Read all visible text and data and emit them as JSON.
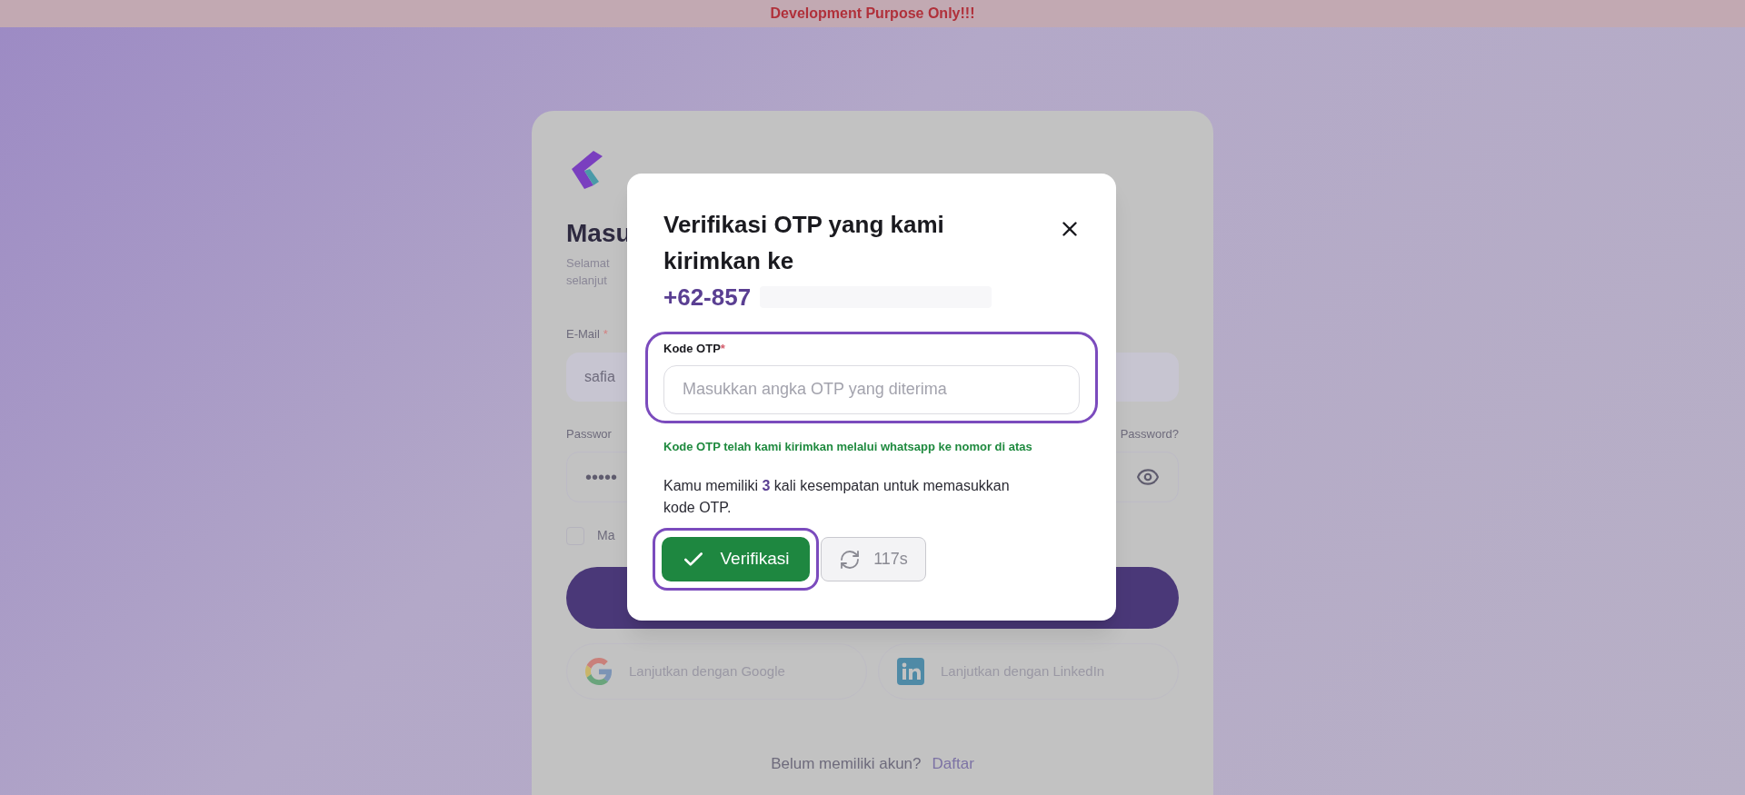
{
  "banner": {
    "text": "Development Purpose Only!!!"
  },
  "login_card": {
    "heading": "Masu",
    "subtitle_lines": [
      "Selamat",
      "selanjut"
    ],
    "email": {
      "label": "E-Mail",
      "required": true,
      "required_mark": "*",
      "value": "safia"
    },
    "password": {
      "label": "Passwor",
      "value": "•••••",
      "forgot_link": "Password?"
    },
    "remember": {
      "label": "Ma",
      "checked": false
    },
    "social_buttons": [
      {
        "kind": "google",
        "label": "Lanjutkan dengan Google"
      },
      {
        "kind": "linkedin",
        "label": "Lanjutkan dengan LinkedIn"
      }
    ],
    "footer": {
      "text": "Belum memiliki akun?",
      "link": "Daftar"
    }
  },
  "modal": {
    "title": "Verifikasi OTP yang kami kirimkan ke",
    "phone": "+62-857",
    "field": {
      "label": "Kode OTP",
      "required": true,
      "required_mark": "*",
      "placeholder": "Masukkan angka OTP yang diterima",
      "focused": true
    },
    "hint": "Kode OTP telah kami kirimkan melalui whatsapp ke nomor di atas",
    "info": {
      "before": "Kamu memiliki ",
      "count": "3",
      "after": " kali kesempatan untuk memasukkan kode OTP."
    },
    "verify_button": {
      "label": "Verifikasi",
      "focused": true
    },
    "resend_button": {
      "label": "117s",
      "disabled": true
    }
  }
}
